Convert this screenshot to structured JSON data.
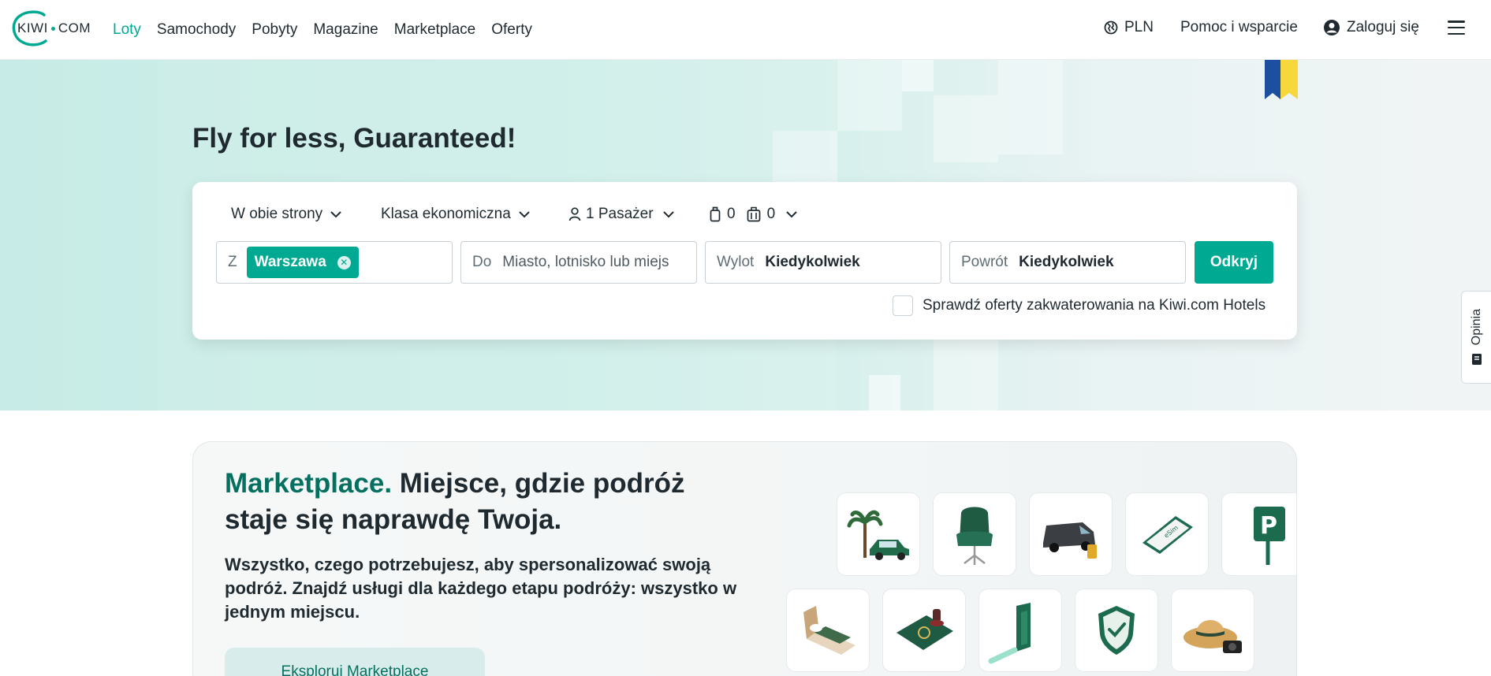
{
  "header": {
    "logo_text": "KIWI",
    "logo_suffix": "COM",
    "nav": [
      "Loty",
      "Samochody",
      "Pobyty",
      "Magazine",
      "Marketplace",
      "Oferty"
    ],
    "currency": "PLN",
    "help": "Pomoc i wsparcie",
    "login": "Zaloguj się"
  },
  "hero": {
    "title": "Fly for less, Guaranteed!"
  },
  "search": {
    "trip_type": "W obie strony",
    "cabin_class": "Klasa ekonomiczna",
    "passengers": "1 Pasażer",
    "cabin_bags": "0",
    "checked_bags": "0",
    "from_label": "Z",
    "from_value": "Warszawa",
    "to_label": "Do",
    "to_placeholder": "Miasto, lotnisko lub miejs",
    "depart_label": "Wylot",
    "depart_value": "Kiedykolwiek",
    "return_label": "Powrót",
    "return_value": "Kiedykolwiek",
    "submit": "Odkryj",
    "hotels_check": "Sprawdź oferty zakwaterowania na Kiwi.com Hotels"
  },
  "feedback": "Opinia",
  "marketplace": {
    "title_accent": "Marketplace.",
    "title_rest": " Miejsce, gdzie podróż staje się naprawdę Twoja.",
    "description": "Wszystko, czego potrzebujesz, aby spersonalizować swoją podróż. Znajdź usługi dla każdego etapu podróży: wszystko w jednym miejscu.",
    "button": "Eksploruj Marketplace"
  },
  "colors": {
    "accent": "#00a991",
    "accent_dark": "#05705f",
    "text": "#1f2a30",
    "flag_blue": "#1c4fa0",
    "flag_yellow": "#f7d83c"
  },
  "icons": [
    "globe-icon",
    "user-icon",
    "menu-icon",
    "chevron-down-icon",
    "person-icon",
    "cabin-bag-icon",
    "checked-bag-icon",
    "close-icon",
    "feedback-icon"
  ]
}
